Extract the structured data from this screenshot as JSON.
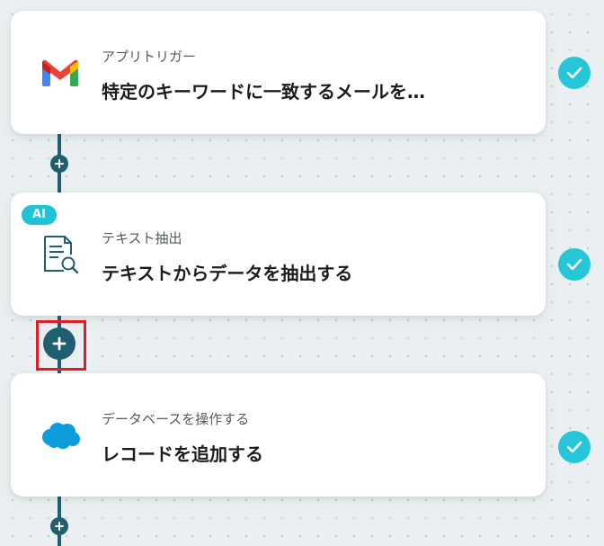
{
  "steps": [
    {
      "subtitle": "アプリトリガー",
      "title": "特定のキーワードに一致するメールを…",
      "icon": "gmail-icon",
      "status": "completed"
    },
    {
      "badge": "AI",
      "subtitle": "テキスト抽出",
      "title": "テキストからデータを抽出する",
      "icon": "document-search-icon",
      "status": "completed"
    },
    {
      "subtitle": "データベースを操作する",
      "title": "レコードを追加する",
      "icon": "salesforce-cloud-icon",
      "status": "completed"
    }
  ],
  "colors": {
    "connector": "#1f5f70",
    "check": "#26c6d9",
    "ai_badge": "#1fc3d6",
    "highlight": "#e11d2a",
    "salesforce": "#0d9dda"
  }
}
